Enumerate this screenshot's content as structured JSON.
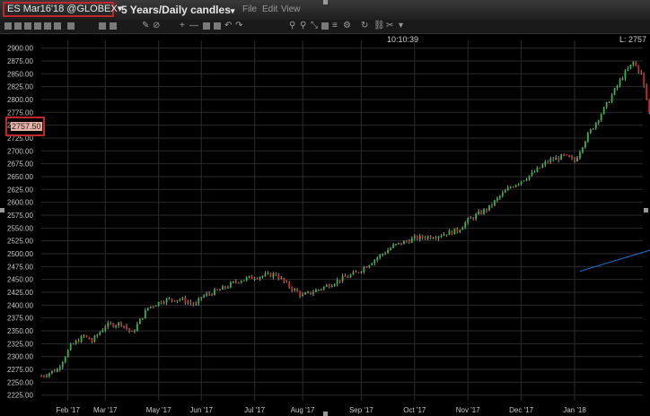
{
  "header": {
    "symbol": "ES Mar16'18 @GLOBEX",
    "symbol_caret": "▾",
    "timeframe": "5 Years/Daily candles",
    "timeframe_caret": "▾",
    "menu": [
      "File",
      "Edit",
      "View"
    ]
  },
  "readouts": {
    "time": "10:10:39",
    "last": "L: 2757",
    "current_price": "2757.50"
  },
  "colors": {
    "up": "#35b44a",
    "down": "#d02828",
    "wick": "#9a9a9a",
    "grid": "#2b2b2b",
    "axis_text": "#c8c8c8",
    "trend": "#1f6fd1",
    "highlight": "#c0272d"
  },
  "chart_data": {
    "type": "candlestick",
    "ylim": [
      2214,
      2915
    ],
    "y_ticks": [
      2225,
      2250,
      2275,
      2300,
      2325,
      2350,
      2375,
      2400,
      2425,
      2450,
      2475,
      2500,
      2525,
      2550,
      2575,
      2600,
      2625,
      2650,
      2675,
      2700,
      2725,
      2750,
      2775,
      2800,
      2825,
      2850,
      2875,
      2900
    ],
    "y_tick_labels": [
      "2225.00",
      "2250.00",
      "2275.00",
      "2300.00",
      "2325.00",
      "2350.00",
      "2375.00",
      "2400.00",
      "2425.00",
      "2450.00",
      "2475.00",
      "2500.00",
      "2525.00",
      "2550.00",
      "2575.00",
      "2600.00",
      "2625.00",
      "2650.00",
      "2675.00",
      "2700.00",
      "2725.00",
      "2750.00",
      "2775.00",
      "2800.00",
      "2825.00",
      "2850.00",
      "2875.00",
      "2900.00"
    ],
    "x_labels": [
      "Feb '17",
      "Mar '17",
      "May '17",
      "Jun '17",
      "Jul '17",
      "Aug '17",
      "Sep '17",
      "Oct '17",
      "Nov '17",
      "Dec '17",
      "Jan '18"
    ],
    "x_positions": [
      0.05,
      0.12,
      0.22,
      0.3,
      0.4,
      0.49,
      0.6,
      0.7,
      0.8,
      0.9,
      1.0
    ],
    "x_range": [
      0.0,
      1.19
    ],
    "path": [
      [
        0.0,
        2262
      ],
      [
        0.03,
        2275
      ],
      [
        0.055,
        2320
      ],
      [
        0.08,
        2340
      ],
      [
        0.095,
        2330
      ],
      [
        0.12,
        2360
      ],
      [
        0.15,
        2365
      ],
      [
        0.17,
        2345
      ],
      [
        0.2,
        2395
      ],
      [
        0.23,
        2410
      ],
      [
        0.26,
        2412
      ],
      [
        0.29,
        2400
      ],
      [
        0.3,
        2416
      ],
      [
        0.34,
        2432
      ],
      [
        0.37,
        2448
      ],
      [
        0.4,
        2455
      ],
      [
        0.44,
        2460
      ],
      [
        0.46,
        2440
      ],
      [
        0.49,
        2418
      ],
      [
        0.53,
        2435
      ],
      [
        0.56,
        2450
      ],
      [
        0.59,
        2462
      ],
      [
        0.62,
        2485
      ],
      [
        0.66,
        2515
      ],
      [
        0.7,
        2530
      ],
      [
        0.74,
        2535
      ],
      [
        0.78,
        2545
      ],
      [
        0.8,
        2565
      ],
      [
        0.84,
        2590
      ],
      [
        0.86,
        2612
      ],
      [
        0.88,
        2630
      ],
      [
        0.92,
        2655
      ],
      [
        0.95,
        2680
      ],
      [
        0.98,
        2690
      ],
      [
        1.0,
        2680
      ],
      [
        1.02,
        2722
      ],
      [
        1.06,
        2790
      ],
      [
        1.09,
        2845
      ],
      [
        1.11,
        2872
      ],
      [
        1.125,
        2850
      ],
      [
        1.14,
        2775
      ],
      [
        1.145,
        2757.5
      ]
    ],
    "trend_line": [
      [
        1.01,
        2466
      ],
      [
        1.19,
        2522
      ]
    ]
  }
}
